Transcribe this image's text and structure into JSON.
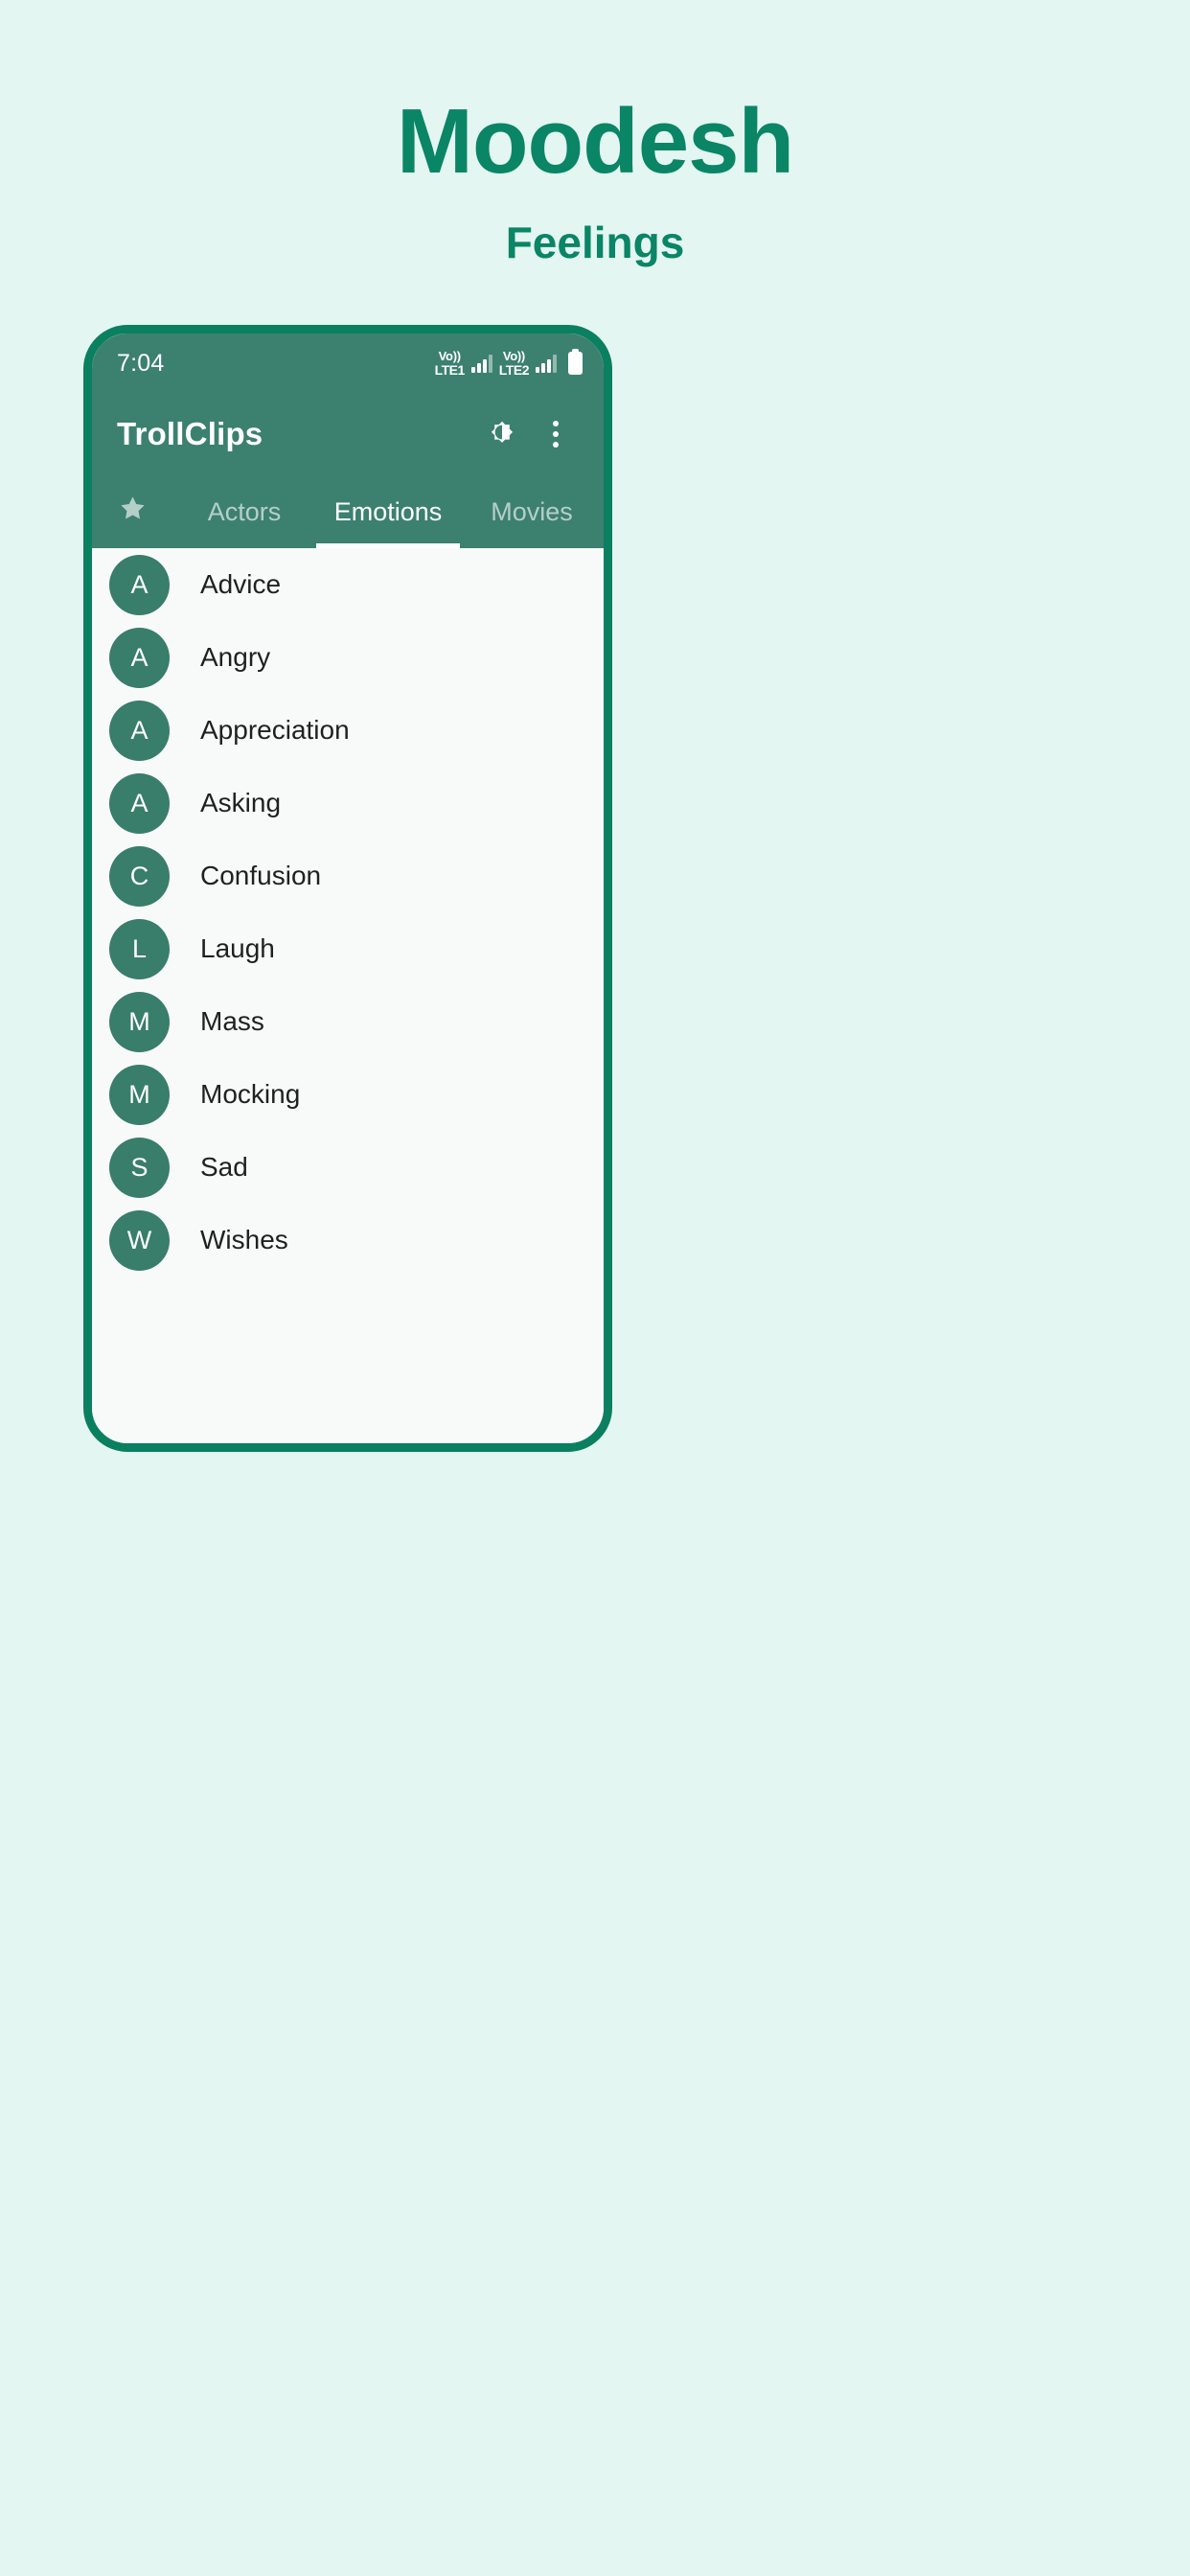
{
  "promo": {
    "title": "Moodesh",
    "subtitle": "Feelings",
    "accent_color": "#0a8565",
    "background_color": "#e4f6f2"
  },
  "phone": {
    "frame_color": "#0a8060",
    "screen_background": "#f8faf9",
    "status_bar": {
      "time": "7:04",
      "network_1": {
        "top": "Vo))",
        "bottom": "LTE1",
        "icon": "signal-bars-icon"
      },
      "network_2": {
        "top": "Vo))",
        "bottom": "LTE2",
        "icon": "signal-bars-icon"
      },
      "battery_icon": "battery-icon",
      "background_color": "#3c8070"
    },
    "app_bar": {
      "title": "TrollClips",
      "theme_toggle_icon": "brightness-toggle-icon",
      "overflow_icon": "more-vertical-icon"
    },
    "tabs": [
      {
        "label": "",
        "icon": "star-icon",
        "active": false
      },
      {
        "label": "Actors",
        "icon": "",
        "active": false
      },
      {
        "label": "Emotions",
        "icon": "",
        "active": true
      },
      {
        "label": "Movies",
        "icon": "",
        "active": false
      }
    ],
    "list": {
      "avatar_color": "#387e6a",
      "items": [
        {
          "initial": "A",
          "label": "Advice"
        },
        {
          "initial": "A",
          "label": "Angry"
        },
        {
          "initial": "A",
          "label": "Appreciation"
        },
        {
          "initial": "A",
          "label": "Asking"
        },
        {
          "initial": "C",
          "label": "Confusion"
        },
        {
          "initial": "L",
          "label": "Laugh"
        },
        {
          "initial": "M",
          "label": "Mass"
        },
        {
          "initial": "M",
          "label": "Mocking"
        },
        {
          "initial": "S",
          "label": "Sad"
        },
        {
          "initial": "W",
          "label": "Wishes"
        }
      ]
    }
  }
}
